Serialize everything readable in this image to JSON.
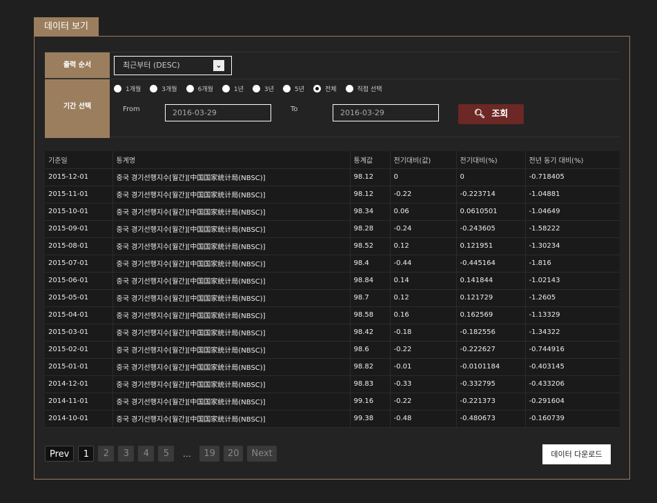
{
  "tab": "데이터 보기",
  "form": {
    "order_label": "출력 순서",
    "order_value": "최근부터 (DESC)",
    "period_label": "기간 선택",
    "radios": [
      {
        "label": "1개월",
        "checked": false
      },
      {
        "label": "3개월",
        "checked": false
      },
      {
        "label": "6개월",
        "checked": false
      },
      {
        "label": "1년",
        "checked": false
      },
      {
        "label": "3년",
        "checked": false
      },
      {
        "label": "5년",
        "checked": false
      },
      {
        "label": "전체",
        "checked": true
      },
      {
        "label": "직접 선택",
        "checked": false
      }
    ],
    "from_label": "From",
    "from_value": "2016-03-29",
    "to_label": "To",
    "to_value": "2016-03-29",
    "search_label": "조회"
  },
  "table": {
    "headers": [
      "기준일",
      "통계명",
      "통계값",
      "전기대비(값)",
      "전기대비(%)",
      "전년 동기 대비(%)"
    ],
    "rows": [
      [
        "2015-12-01",
        "중국 경기선행지수[월간][中国国家统计局(NBSC)]",
        "98.12",
        "0",
        "0",
        "-0.718405"
      ],
      [
        "2015-11-01",
        "중국 경기선행지수[월간][中国国家统计局(NBSC)]",
        "98.12",
        "-0.22",
        "-0.223714",
        "-1.04881"
      ],
      [
        "2015-10-01",
        "중국 경기선행지수[월간][中国国家统计局(NBSC)]",
        "98.34",
        "0.06",
        "0.0610501",
        "-1.04649"
      ],
      [
        "2015-09-01",
        "중국 경기선행지수[월간][中国国家统计局(NBSC)]",
        "98.28",
        "-0.24",
        "-0.243605",
        "-1.58222"
      ],
      [
        "2015-08-01",
        "중국 경기선행지수[월간][中国国家统计局(NBSC)]",
        "98.52",
        "0.12",
        "0.121951",
        "-1.30234"
      ],
      [
        "2015-07-01",
        "중국 경기선행지수[월간][中国国家统计局(NBSC)]",
        "98.4",
        "-0.44",
        "-0.445164",
        "-1.816"
      ],
      [
        "2015-06-01",
        "중국 경기선행지수[월간][中国国家统计局(NBSC)]",
        "98.84",
        "0.14",
        "0.141844",
        "-1.02143"
      ],
      [
        "2015-05-01",
        "중국 경기선행지수[월간][中国国家统计局(NBSC)]",
        "98.7",
        "0.12",
        "0.121729",
        "-1.2605"
      ],
      [
        "2015-04-01",
        "중국 경기선행지수[월간][中国国家统计局(NBSC)]",
        "98.58",
        "0.16",
        "0.162569",
        "-1.13329"
      ],
      [
        "2015-03-01",
        "중국 경기선행지수[월간][中国国家统计局(NBSC)]",
        "98.42",
        "-0.18",
        "-0.182556",
        "-1.34322"
      ],
      [
        "2015-02-01",
        "중국 경기선행지수[월간][中国国家统计局(NBSC)]",
        "98.6",
        "-0.22",
        "-0.222627",
        "-0.744916"
      ],
      [
        "2015-01-01",
        "중국 경기선행지수[월간][中国国家统计局(NBSC)]",
        "98.82",
        "-0.01",
        "-0.0101184",
        "-0.403145"
      ],
      [
        "2014-12-01",
        "중국 경기선행지수[월간][中国国家统计局(NBSC)]",
        "98.83",
        "-0.33",
        "-0.332795",
        "-0.433206"
      ],
      [
        "2014-11-01",
        "중국 경기선행지수[월간][中国国家统计局(NBSC)]",
        "99.16",
        "-0.22",
        "-0.221373",
        "-0.291604"
      ],
      [
        "2014-10-01",
        "중국 경기선행지수[월간][中国国家统计局(NBSC)]",
        "99.38",
        "-0.48",
        "-0.480673",
        "-0.160739"
      ]
    ]
  },
  "pager": {
    "prev": "Prev",
    "pages": [
      "1",
      "2",
      "3",
      "4",
      "5"
    ],
    "ellipsis": "…",
    "last_pages": [
      "19",
      "20"
    ],
    "next": "Next",
    "current": "1"
  },
  "download_label": "데이터 다운로드"
}
